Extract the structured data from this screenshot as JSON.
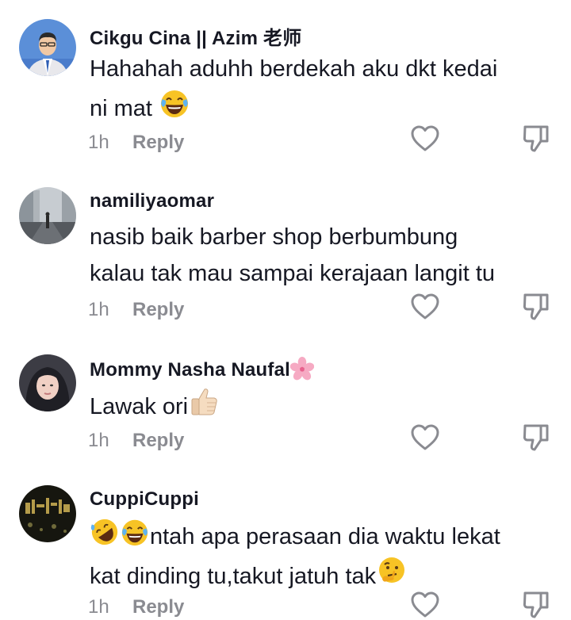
{
  "comments": [
    {
      "username": "Cikgu Cina || Azim 老师",
      "line1": "Hahahah aduhh berdekah aku dkt kedai",
      "line2": "ni mat",
      "time": "1h",
      "reply": "Reply"
    },
    {
      "username": "namiliyaomar",
      "line1": "nasib baik barber shop berbumbung",
      "line2": "kalau tak mau sampai kerajaan langit tu",
      "time": "1h",
      "reply": "Reply"
    },
    {
      "username": "Mommy Nasha Naufal",
      "line1": "Lawak ori",
      "time": "1h",
      "reply": "Reply"
    },
    {
      "username": "CuppiCuppi",
      "line1": "ntah apa perasaan dia waktu lekat",
      "line2": "kat dinding tu,takut jatuh tak",
      "time": "1h",
      "reply": "Reply"
    }
  ],
  "icons": {
    "like": "heart-outline-icon",
    "dislike": "thumbs-down-outline-icon"
  }
}
